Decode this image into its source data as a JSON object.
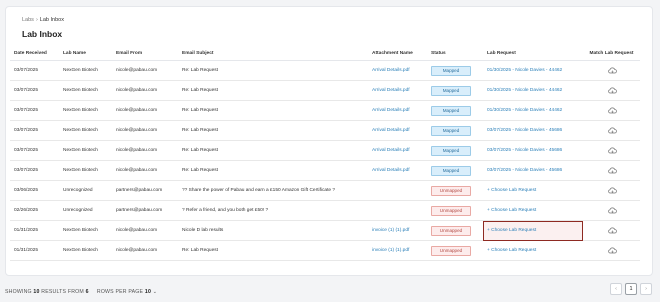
{
  "breadcrumb": {
    "root": "Labs",
    "separator": "›",
    "current": "Lab Inbox"
  },
  "page_title": "Lab Inbox",
  "table": {
    "headers": [
      "Date Received",
      "Lab Name",
      "Email From",
      "Email Subject",
      "Attachment Name",
      "Status",
      "Lab Request",
      "Match Lab Request"
    ],
    "rows": [
      {
        "date": "03/07/2025",
        "lab": "NexGen Biotech",
        "from": "nicole@pabau.com",
        "subject": "Re: Lab Request",
        "attachment": "Arrival Details.pdf",
        "status": "Mapped",
        "request": "01/30/2025 - Nicole Davies - 44462",
        "request_type": "link"
      },
      {
        "date": "03/07/2025",
        "lab": "NexGen Biotech",
        "from": "nicole@pabau.com",
        "subject": "Re: Lab Request",
        "attachment": "Arrival Details.pdf",
        "status": "Mapped",
        "request": "01/30/2025 - Nicole Davies - 44462",
        "request_type": "link"
      },
      {
        "date": "03/07/2025",
        "lab": "NexGen Biotech",
        "from": "nicole@pabau.com",
        "subject": "Re: Lab Request",
        "attachment": "Arrival Details.pdf",
        "status": "Mapped",
        "request": "01/30/2025 - Nicole Davies - 44462",
        "request_type": "link"
      },
      {
        "date": "03/07/2025",
        "lab": "NexGen Biotech",
        "from": "nicole@pabau.com",
        "subject": "Re: Lab Request",
        "attachment": "Arrival Details.pdf",
        "status": "Mapped",
        "request": "03/07/2025 - Nicole Davies - 45686",
        "request_type": "link"
      },
      {
        "date": "03/07/2025",
        "lab": "NexGen Biotech",
        "from": "nicole@pabau.com",
        "subject": "Re: Lab Request",
        "attachment": "Arrival Details.pdf",
        "status": "Mapped",
        "request": "03/07/2025 - Nicole Davies - 45686",
        "request_type": "link"
      },
      {
        "date": "03/07/2025",
        "lab": "NexGen Biotech",
        "from": "nicole@pabau.com",
        "subject": "Re: Lab Request",
        "attachment": "Arrival Details.pdf",
        "status": "Mapped",
        "request": "03/07/2025 - Nicole Davies - 45686",
        "request_type": "link"
      },
      {
        "date": "03/06/2025",
        "lab": "Unrecognized",
        "from": "partners@pabau.com",
        "subject": "?? Share the power of Pabau and earn a £150 Amazon Gift Certificate ?",
        "attachment": "",
        "status": "Unmapped",
        "request": "+ Choose Lab Request",
        "request_type": "choose"
      },
      {
        "date": "02/26/2025",
        "lab": "Unrecognized",
        "from": "partners@pabau.com",
        "subject": "? Refer a friend, and you both get £50! ?",
        "attachment": "",
        "status": "Unmapped",
        "request": "+ Choose Lab Request",
        "request_type": "choose"
      },
      {
        "date": "01/31/2025",
        "lab": "NexGen Biotech",
        "from": "nicole@pabau.com",
        "subject": "Nicole D lab results",
        "attachment": "invoice (1) (1).pdf",
        "status": "Unmapped",
        "request": "+ Choose Lab Request",
        "request_type": "choose",
        "highlighted": true
      },
      {
        "date": "01/31/2025",
        "lab": "NexGen Biotech",
        "from": "nicole@pabau.com",
        "subject": "Re: Lab Request",
        "attachment": "invoice (1) (1).pdf",
        "status": "Unmapped",
        "request": "+ Choose Lab Request",
        "request_type": "choose"
      }
    ]
  },
  "footer": {
    "showing_prefix": "SHOWING",
    "showing_count": "10",
    "results_from": "RESULTS FROM",
    "total": "6",
    "rows_per_page_label": "ROWS PER PAGE",
    "rows_per_page": "10",
    "current_page": "1"
  },
  "colors": {
    "link": "#2a7fb8",
    "mapped_bg": "#d9eefb",
    "unmapped_bg": "#fdecec",
    "highlight": "#8e2a22"
  },
  "icons": {
    "match": "cloud-sync-icon",
    "prev": "chevron-left-icon",
    "next": "chevron-right-icon"
  }
}
